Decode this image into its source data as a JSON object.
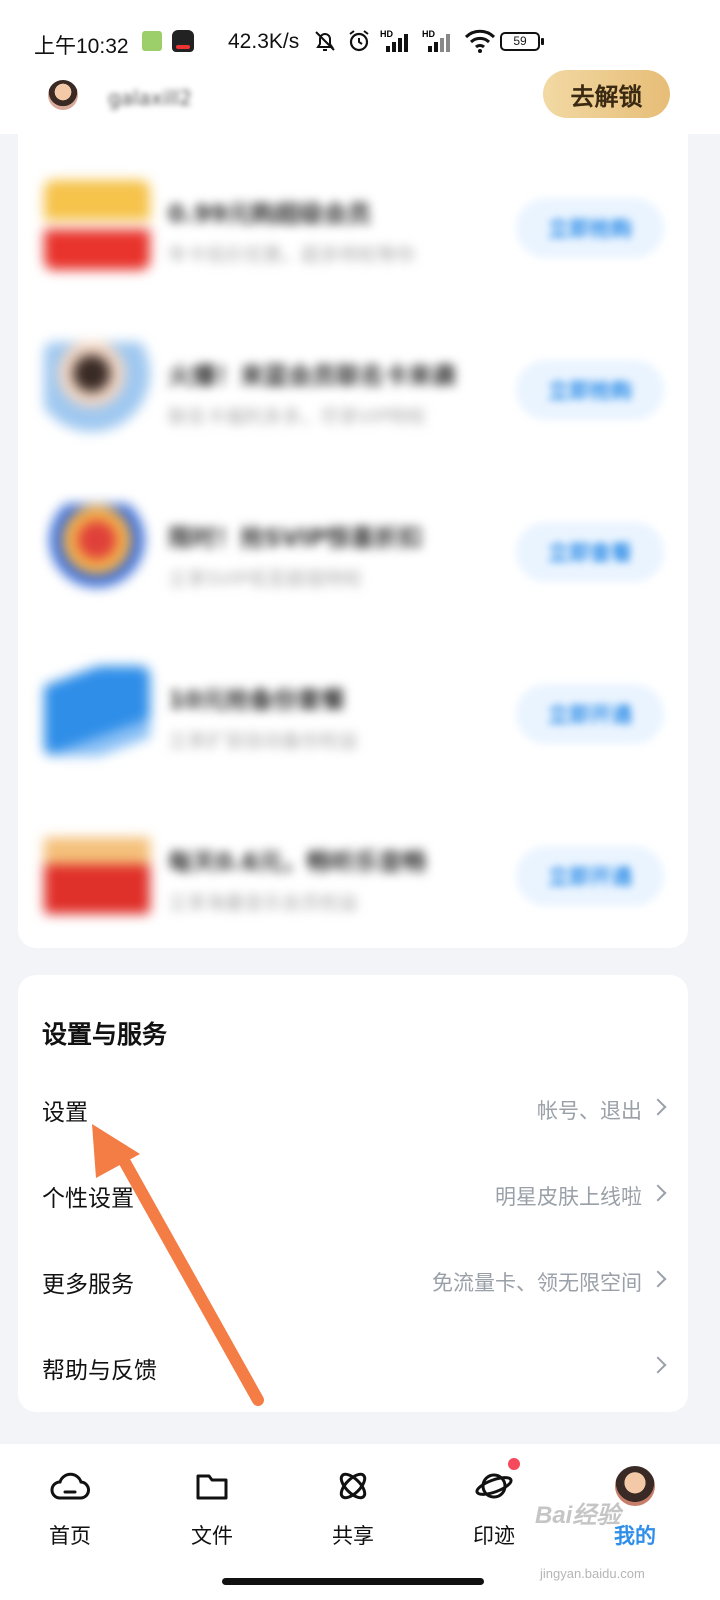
{
  "status_bar": {
    "time": "上午10:32",
    "net_speed": "42.3K/s",
    "battery": "59"
  },
  "header": {
    "username": "galaxill2",
    "unlock_label": "去解锁"
  },
  "promo_items": [
    {
      "title": "0.99元购超级会员",
      "subtitle": "年卡低价优惠，超多特权等你",
      "button": "立即抢购",
      "thumb_color": "#f0b040"
    },
    {
      "title": "火爆！来蓝会员联名卡来袭",
      "subtitle": "联名卡福利多多，尽享VIP特权",
      "button": "立即抢购",
      "thumb_color": "#7fb3e8"
    },
    {
      "title": "限时！抢SVIP惊喜折扣",
      "subtitle": "立享SVIP低至超值特权",
      "button": "立即查看",
      "thumb_color": "#e05a3a"
    },
    {
      "title": "10元抢备份套餐",
      "subtitle": "立享扩容自动备份权益",
      "button": "立即开通",
      "thumb_color": "#3a8ee8"
    },
    {
      "title": "每天0.6元，畅听乐音畅",
      "subtitle": "立享海量音乐会员权益",
      "button": "立即开通",
      "thumb_color": "#e0403a"
    }
  ],
  "settings": {
    "title": "设置与服务",
    "rows": [
      {
        "label": "设置",
        "hint": "帐号、退出"
      },
      {
        "label": "个性设置",
        "hint": "明星皮肤上线啦"
      },
      {
        "label": "更多服务",
        "hint": "免流量卡、领无限空间"
      },
      {
        "label": "帮助与反馈",
        "hint": ""
      }
    ]
  },
  "bottom_nav": {
    "items": [
      {
        "label": "首页",
        "icon": "cloud-icon"
      },
      {
        "label": "文件",
        "icon": "folder-icon"
      },
      {
        "label": "共享",
        "icon": "atom-icon"
      },
      {
        "label": "印迹",
        "icon": "planet-icon"
      },
      {
        "label": "我的",
        "icon": "avatar"
      }
    ]
  },
  "watermark": {
    "brand": "Bai经验",
    "url": "jingyan.baidu.com"
  },
  "colors": {
    "accent": "#2f8ee8",
    "unlock_gold": "#e6bd77",
    "arrow": "#f47c45",
    "badge_red": "#f44a5b"
  }
}
